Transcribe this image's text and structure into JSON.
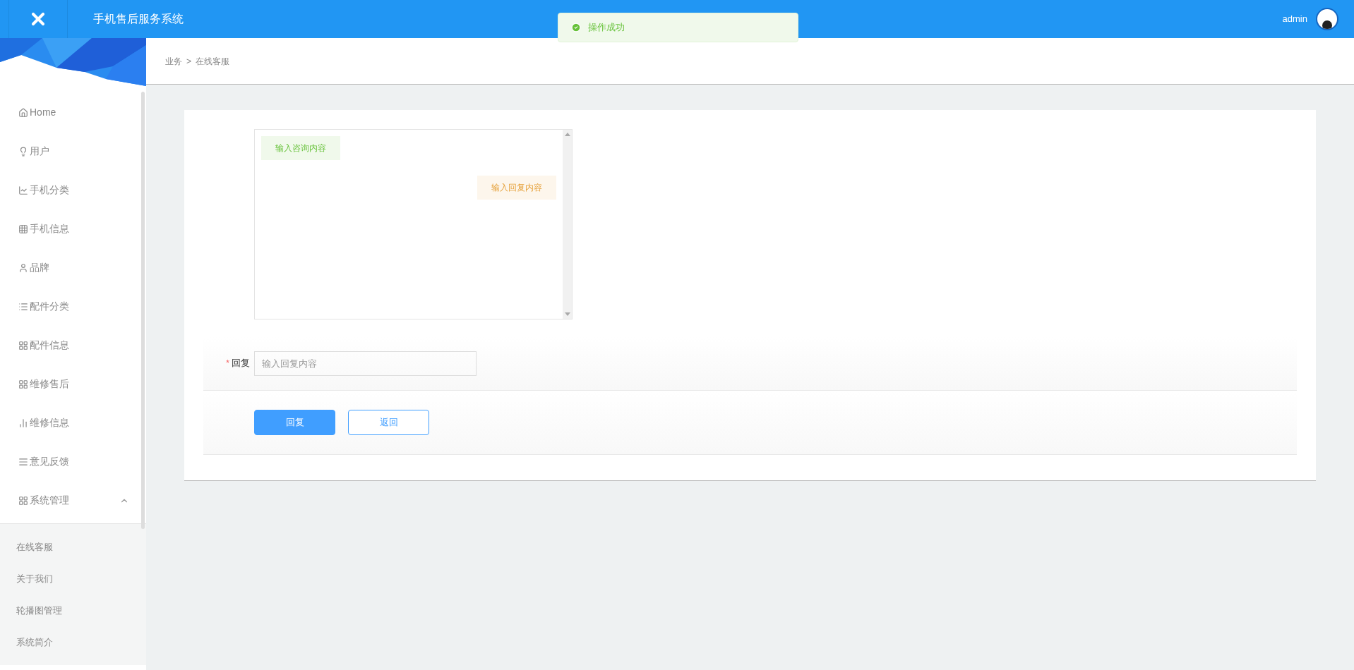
{
  "header": {
    "title": "手机售后服务系统",
    "user": "admin"
  },
  "toast": {
    "message": "操作成功"
  },
  "breadcrumb": [
    "业务",
    "在线客服"
  ],
  "breadcrumb_separator": ">",
  "sidebar": {
    "items": [
      {
        "label": "Home"
      },
      {
        "label": "用户"
      },
      {
        "label": "手机分类"
      },
      {
        "label": "手机信息"
      },
      {
        "label": "品牌"
      },
      {
        "label": "配件分类"
      },
      {
        "label": "配件信息"
      },
      {
        "label": "维修售后"
      },
      {
        "label": "维修信息"
      },
      {
        "label": "意见反馈"
      },
      {
        "label": "系统管理",
        "expanded": true,
        "children": [
          {
            "label": "在线客服"
          },
          {
            "label": "关于我们"
          },
          {
            "label": "轮播图管理"
          },
          {
            "label": "系统简介"
          }
        ]
      }
    ]
  },
  "chat": {
    "messages": [
      {
        "kind": "question",
        "text": "输入咨询内容"
      },
      {
        "kind": "answer",
        "text": "输入回复内容"
      }
    ]
  },
  "form": {
    "required_mark": "*",
    "label": "回复",
    "placeholder": "输入回复内容"
  },
  "buttons": [
    {
      "kind": "primary",
      "label": "回复"
    },
    {
      "kind": "plain",
      "label": "返回"
    }
  ]
}
